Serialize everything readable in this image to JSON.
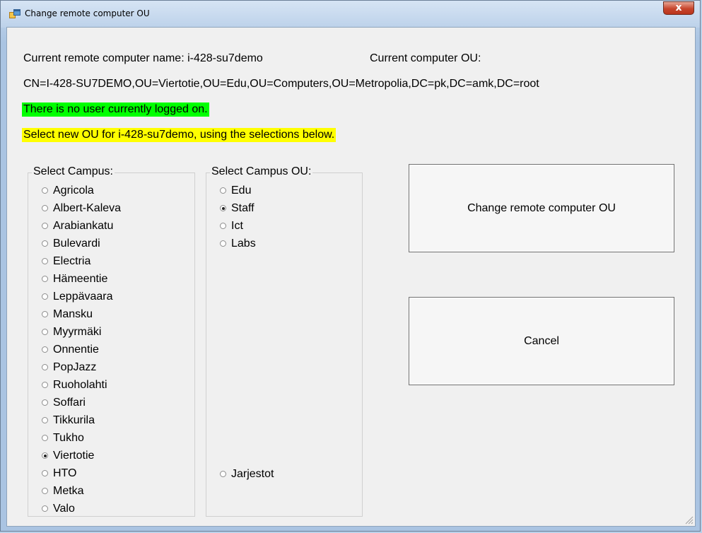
{
  "window": {
    "title": "Change remote computer OU"
  },
  "titlebar": {
    "close_symbol": "x"
  },
  "info": {
    "current_name": "Current remote computer name: i-428-su7demo",
    "current_ou_label": "Current computer OU:",
    "current_ou_value": "CN=I-428-SU7DEMO,OU=Viertotie,OU=Edu,OU=Computers,OU=Metropolia,DC=pk,DC=amk,DC=root",
    "logged_status": "There is no user currently logged on.",
    "instruction": "Select new OU for i-428-su7demo, using the selections below."
  },
  "campus": {
    "legend": "Select Campus:",
    "options": [
      "Agricola",
      "Albert-Kaleva",
      "Arabiankatu",
      "Bulevardi",
      "Electria",
      "Hämeentie",
      "Leppävaara",
      "Mansku",
      "Myyrmäki",
      "Onnentie",
      "PopJazz",
      "Ruoholahti",
      "Soffari",
      "Tikkurila",
      "Tukho",
      "Viertotie",
      "HTO",
      "Metka",
      "Valo"
    ],
    "selected": "Viertotie"
  },
  "campus_ou": {
    "legend": "Select Campus OU:",
    "options": [
      "Edu",
      "Staff",
      "Ict",
      "Labs"
    ],
    "extra_option": "Jarjestot",
    "selected": "Staff"
  },
  "buttons": {
    "change": "Change remote computer OU",
    "cancel": "Cancel"
  },
  "colors": {
    "status_green": "#00ff00",
    "instruction_yellow": "#ffff00",
    "close_red": "#c7452c"
  }
}
